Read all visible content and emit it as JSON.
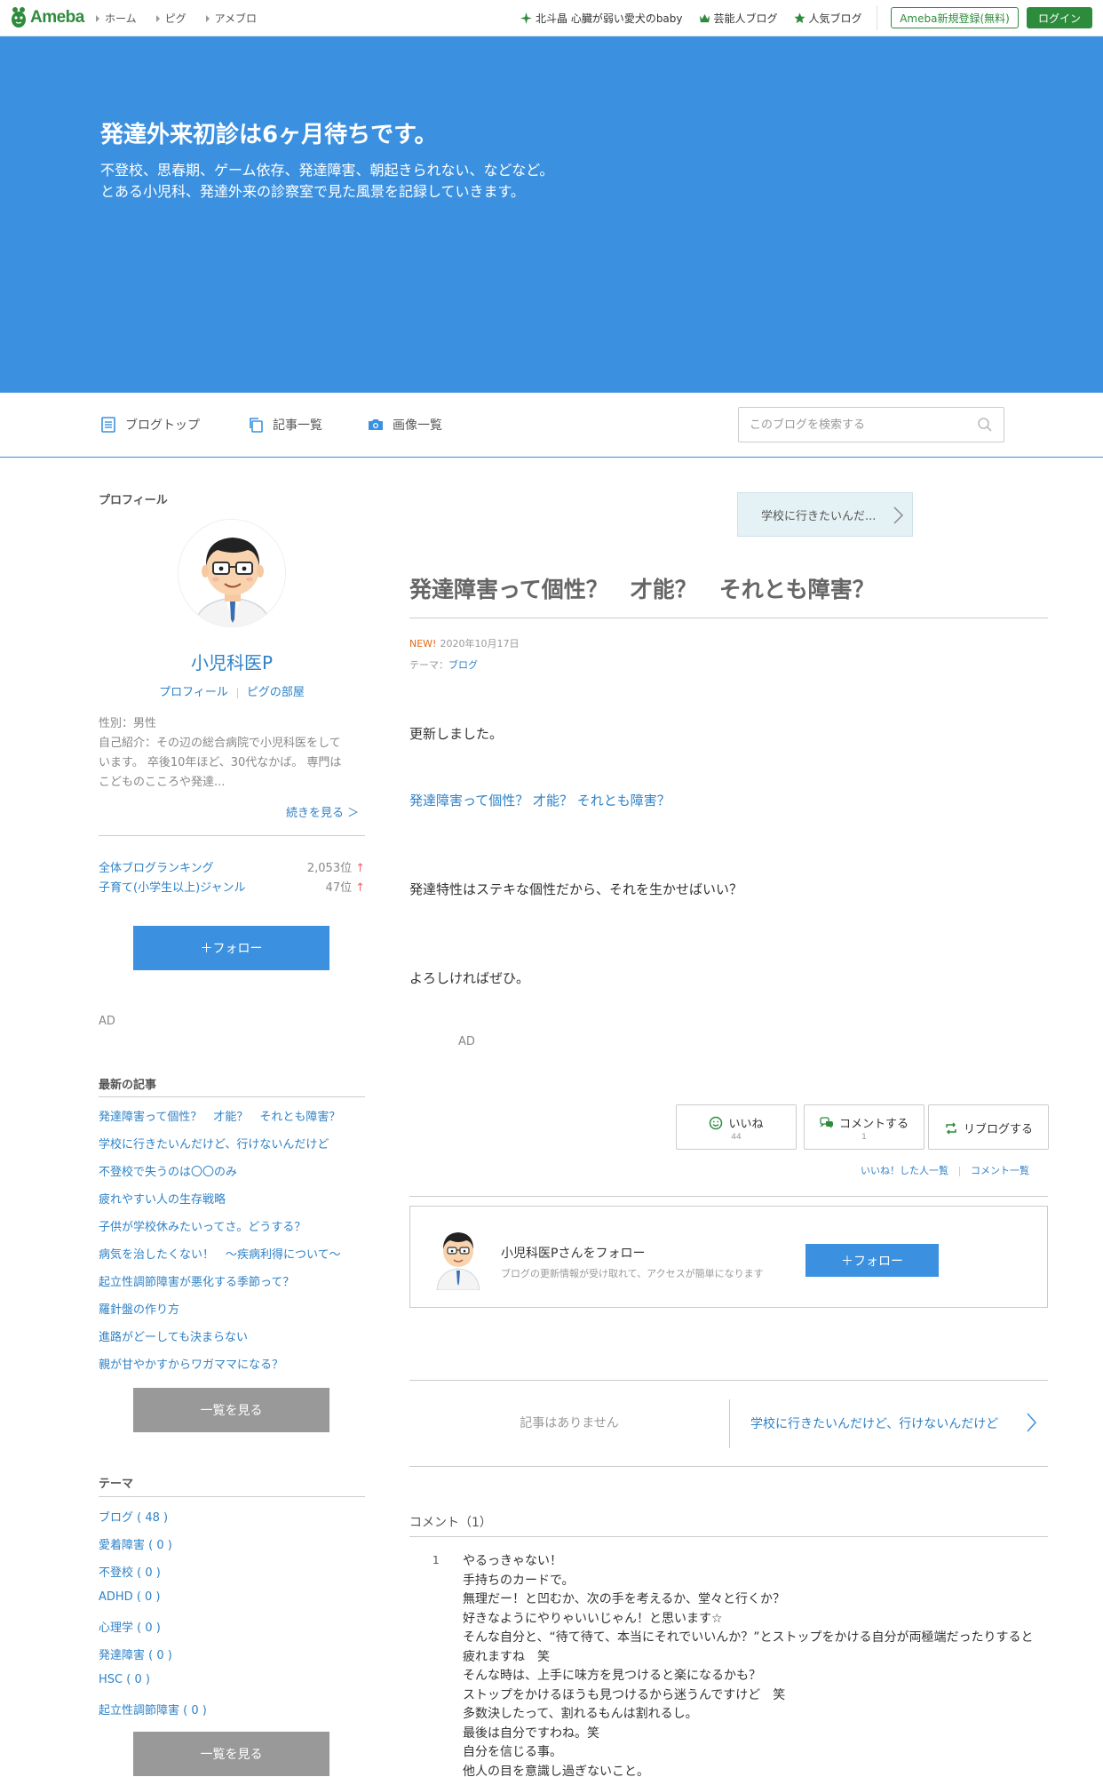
{
  "header": {
    "logo": "Ameba",
    "breadcrumbs": [
      "ホーム",
      "ピグ",
      "アメブロ"
    ],
    "links": [
      "北斗晶 心臓が弱い愛犬のbaby",
      "芸能人ブログ",
      "人気ブログ"
    ],
    "register": "Ameba新規登録(無料)",
    "login": "ログイン"
  },
  "hero": {
    "title": "発達外来初診は6ヶ月待ちです。",
    "desc_line1": "不登校、思春期、ゲーム依存、発達障害、朝起きられない、などなど。",
    "desc_line2": "とある小児科、発達外来の診察室で見た風景を記録していきます。"
  },
  "nav": {
    "top": "ブログトップ",
    "list": "記事一覧",
    "images": "画像一覧",
    "search_placeholder": "このブログを検索する"
  },
  "sidebar": {
    "profile_heading": "プロフィール",
    "name": "小児科医P",
    "profile_link": "プロフィール",
    "pig_link": "ピグの部屋",
    "gender": "性別：男性",
    "intro_1": "自己紹介：その辺の総合病院で小児科医をして",
    "intro_2": "います。 卒後10年ほど、30代なかば。 専門は",
    "intro_3": "こどものこころや発達...",
    "readmore": "続きを見る ＞",
    "ranking": [
      {
        "label": "全体ブログランキング",
        "value": "2,053位",
        "arrow": "↑"
      },
      {
        "label": "子育て(小学生以上)ジャンル",
        "value": "47位",
        "arrow": "↑"
      }
    ],
    "follow": "＋フォロー",
    "ad": "AD",
    "recent_heading": "最新の記事",
    "recent": [
      "発達障害って個性？　才能？　それとも障害？",
      "学校に行きたいんだけど、行けないんだけど",
      "不登校で失うのは〇〇のみ",
      "疲れやすい人の生存戦略",
      "子供が学校休みたいってさ。どうする？",
      "病気を治したくない！　〜疾病利得について〜",
      "起立性調節障害が悪化する季節って？",
      "羅針盤の作り方",
      "進路がどーしても決まらない",
      "親が甘やかすからワガママになる？"
    ],
    "more": "一覧を見る",
    "theme_heading": "テーマ",
    "themes": [
      "ブログ ( 48 )",
      "愛着障害 ( 0 )",
      "不登校 ( 0 )",
      "ADHD ( 0 )",
      "心理学 ( 0 )",
      "発達障害 ( 0 )",
      "HSC ( 0 )",
      "起立性調節障害 ( 0 )"
    ]
  },
  "entry": {
    "prev_title": "学校に行きたいんだ...",
    "title": "発達障害って個性？　才能？　それとも障害？",
    "new_badge": "NEW!",
    "date": "2020年10月17日",
    "theme_label": "テーマ：",
    "theme": "ブログ",
    "p1": "更新しました。",
    "p2": "発達障害って個性？ 才能？ それとも障害？",
    "p3": "発達特性はステキな個性だから、それを生かせばいい？",
    "p4": "よろしければぜひ。",
    "ad": "AD"
  },
  "reactions": {
    "like": "いいね",
    "like_count": "44",
    "comment": "コメントする",
    "comment_count": "1",
    "reblog": "リブログする",
    "like_list": "いいね！した人一覧",
    "comment_list": "コメント一覧"
  },
  "follow_box": {
    "title": "小児科医Pさんをフォロー",
    "sub": "ブログの更新情報が受け取れて、アクセスが簡単になります",
    "button": "＋フォロー"
  },
  "pager": {
    "prev": "記事はありません",
    "next": "学校に行きたいんだけど、行けないんだけど"
  },
  "comments": {
    "heading": "コメント（1）",
    "number": "1",
    "lines": [
      "やるっきゃない！",
      "手持ちのカードで。",
      "無理だー！と凹むか、次の手を考えるか、堂々と行くか？",
      "好きなようにやりゃいいじゃん！と思います☆",
      "そんな自分と、“待て待て、本当にそれでいいんか？”とストップをかける自分が両極端だったりすると",
      "疲れますね　笑",
      "そんな時は、上手に味方を見つけると楽になるかも？",
      "ストップをかけるほうも見つけるから迷うんですけど　笑",
      "多数決したって、割れるもんは割れるし。",
      "最後は自分ですわね。笑",
      "自分を信じる事。",
      "他人の目を意識し過ぎないこと。"
    ]
  },
  "colors": {
    "accent": "#3b91e0",
    "link": "#2f82c7",
    "ameba_green": "#2d8c3c"
  }
}
